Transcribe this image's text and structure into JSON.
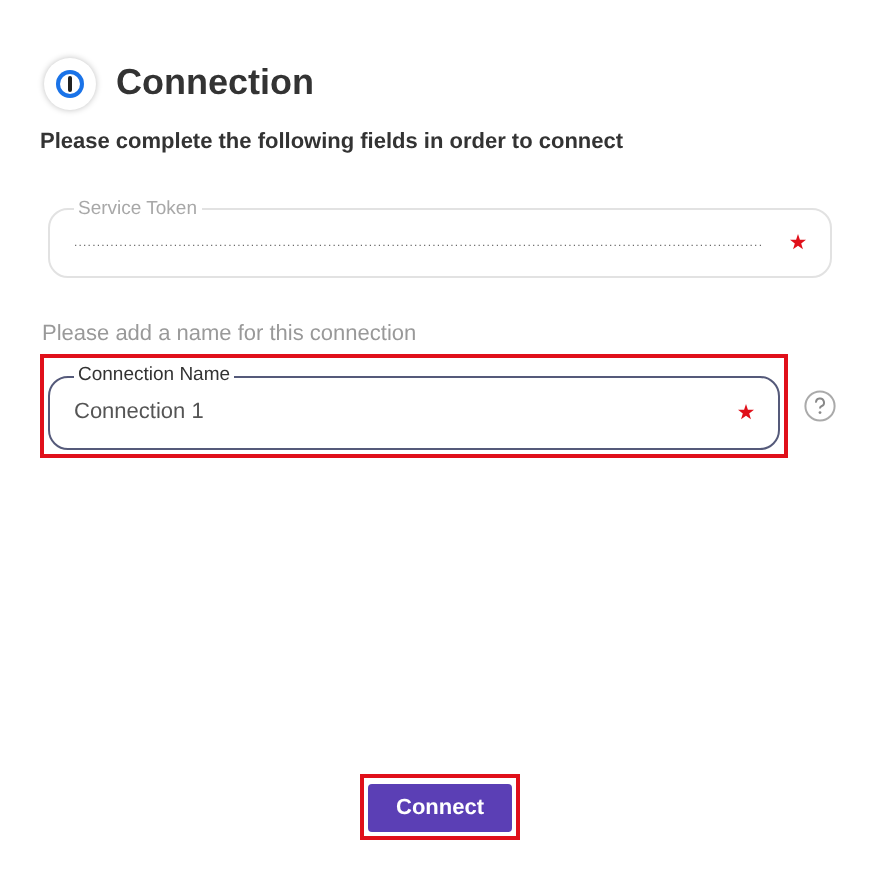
{
  "header": {
    "title": "Connection"
  },
  "instructions": "Please complete the following fields in order to connect",
  "fields": [
    {
      "label": "Service Token",
      "value": "........................................................................................................................................................",
      "required": true,
      "disabled": true,
      "highlighted": false,
      "help": false
    },
    {
      "hint": "Please add a name for this connection",
      "label": "Connection Name",
      "value": "Connection 1",
      "required": true,
      "disabled": false,
      "highlighted": true,
      "help": true
    }
  ],
  "button": {
    "label": "Connect",
    "highlighted": true
  }
}
